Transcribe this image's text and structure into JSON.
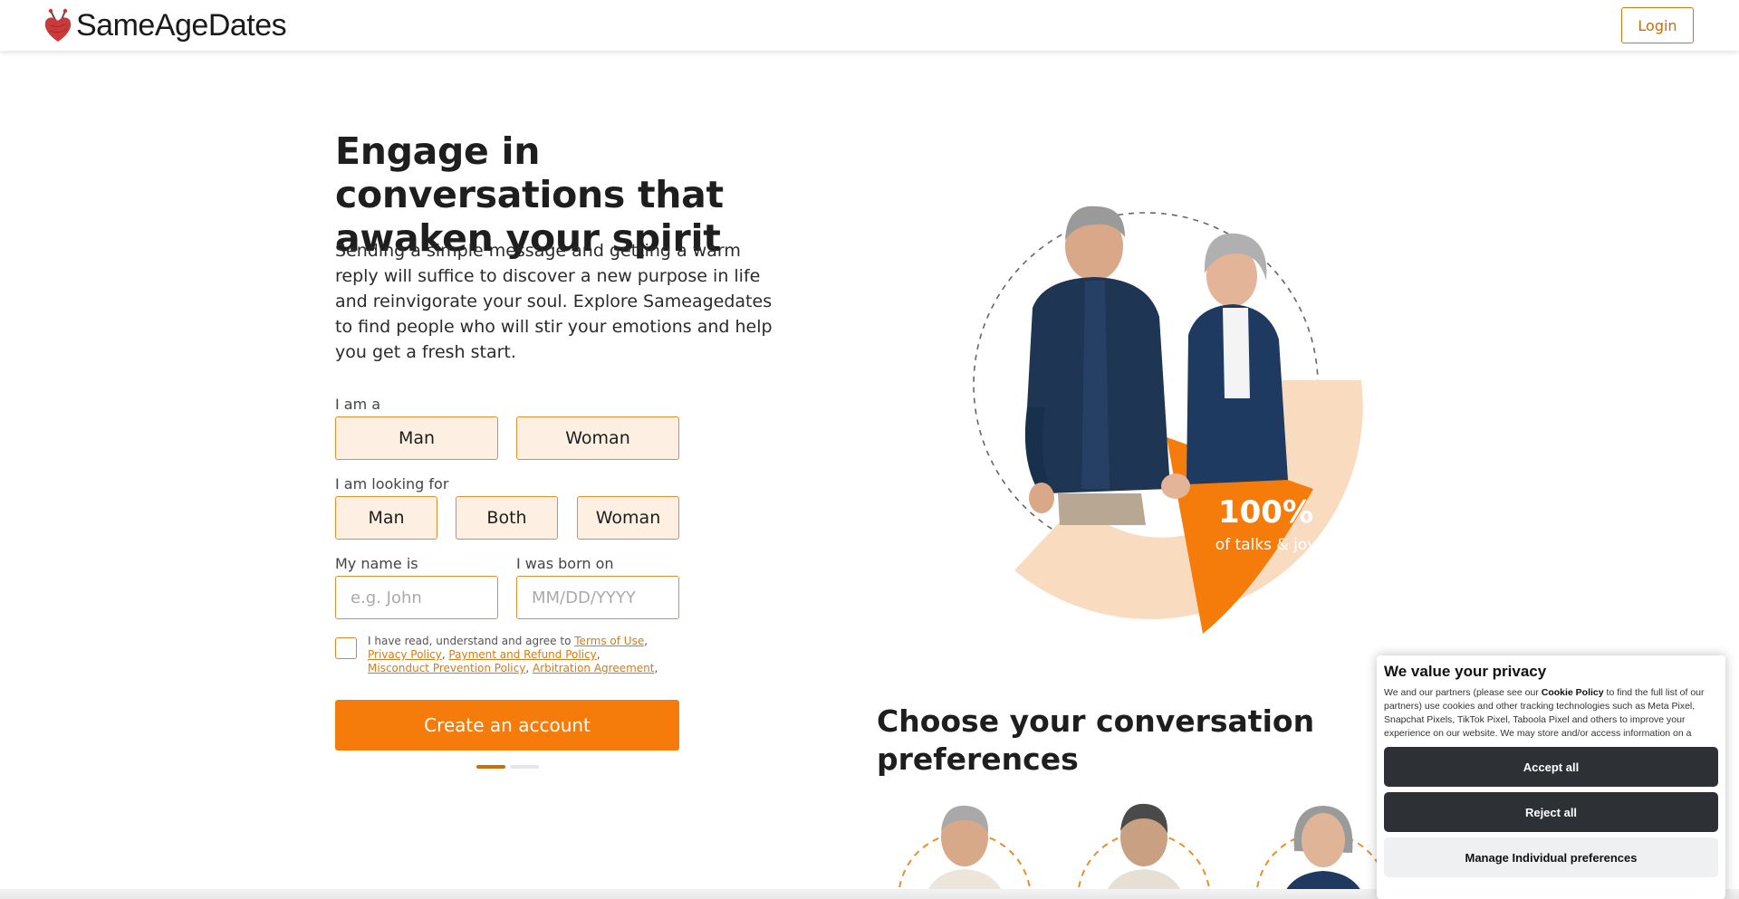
{
  "header": {
    "logo_text": "SameAgeDates",
    "login_label": "Login"
  },
  "hero": {
    "title": "Engage in conversations that awaken your spirit",
    "description": "Sending a simple message and getting a warm reply will suffice to discover a new purpose in life and reinvigorate your soul. Explore Sameagedates to find people who will stir your emotions and help you get a fresh start."
  },
  "form": {
    "iam_label": "I am a",
    "iam_options": [
      "Man",
      "Woman"
    ],
    "looking_label": "I am looking for",
    "looking_options": [
      "Man",
      "Both",
      "Woman"
    ],
    "name_label": "My name is",
    "name_placeholder": "e.g. John",
    "born_label": "I was born on",
    "born_placeholder": "MM/DD/YYYY",
    "terms_prefix": "I have read, understand and agree to",
    "terms_link": "Terms of Use",
    "privacy_link": "Privacy Policy",
    "payment_link": "Payment and Refund Policy",
    "misconduct_link": "Misconduct Prevention Policy",
    "arbitration_link": "Arbitration Agreement",
    "create_label": "Create an account"
  },
  "stat": {
    "value": "100%",
    "caption": "of talks & joy"
  },
  "preferences": {
    "title": "Choose your conversation preferences"
  },
  "cookie": {
    "title": "We value your privacy",
    "text_prefix": "We and our partners (please see our",
    "text_link": "Cookie Policy",
    "text_suffix": "to find the full list of our partners) use cookies and other tracking technologies such as Meta Pixel, Snapchat Pixels, TikTok Pixel, Taboola Pixel and others to improve your experience on our website. We may store and/or access information on a device and process personal",
    "accept_label": "Accept all",
    "reject_label": "Reject all",
    "manage_label": "Manage Individual preferences"
  },
  "colors": {
    "accent": "#f57c0a",
    "accent_light": "#fdefe2",
    "peach": "#f9dcc0",
    "dark_button": "#2d3034"
  }
}
